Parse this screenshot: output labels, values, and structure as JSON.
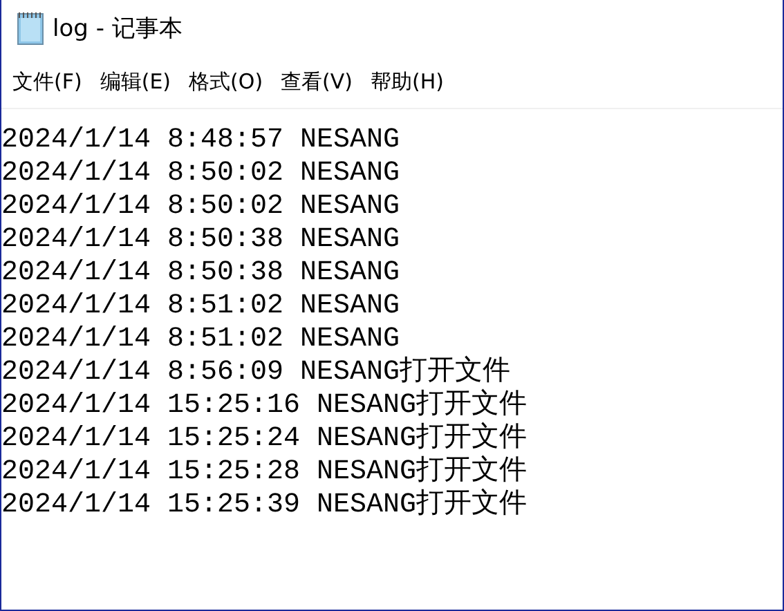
{
  "window": {
    "title": "log - 记事本"
  },
  "menu": [
    "文件(F)",
    "编辑(E)",
    "格式(O)",
    "查看(V)",
    "帮助(H)"
  ],
  "document": {
    "lines": [
      "2024/1/14 8:48:57 NESANG",
      "2024/1/14 8:50:02 NESANG",
      "2024/1/14 8:50:02 NESANG",
      "2024/1/14 8:50:38 NESANG",
      "2024/1/14 8:50:38 NESANG",
      "2024/1/14 8:51:02 NESANG",
      "2024/1/14 8:51:02 NESANG",
      "2024/1/14 8:56:09 NESANG打开文件",
      "2024/1/14 15:25:16 NESANG打开文件",
      "2024/1/14 15:25:24 NESANG打开文件",
      "2024/1/14 15:25:28 NESANG打开文件",
      "2024/1/14 15:25:39 NESANG打开文件"
    ]
  }
}
